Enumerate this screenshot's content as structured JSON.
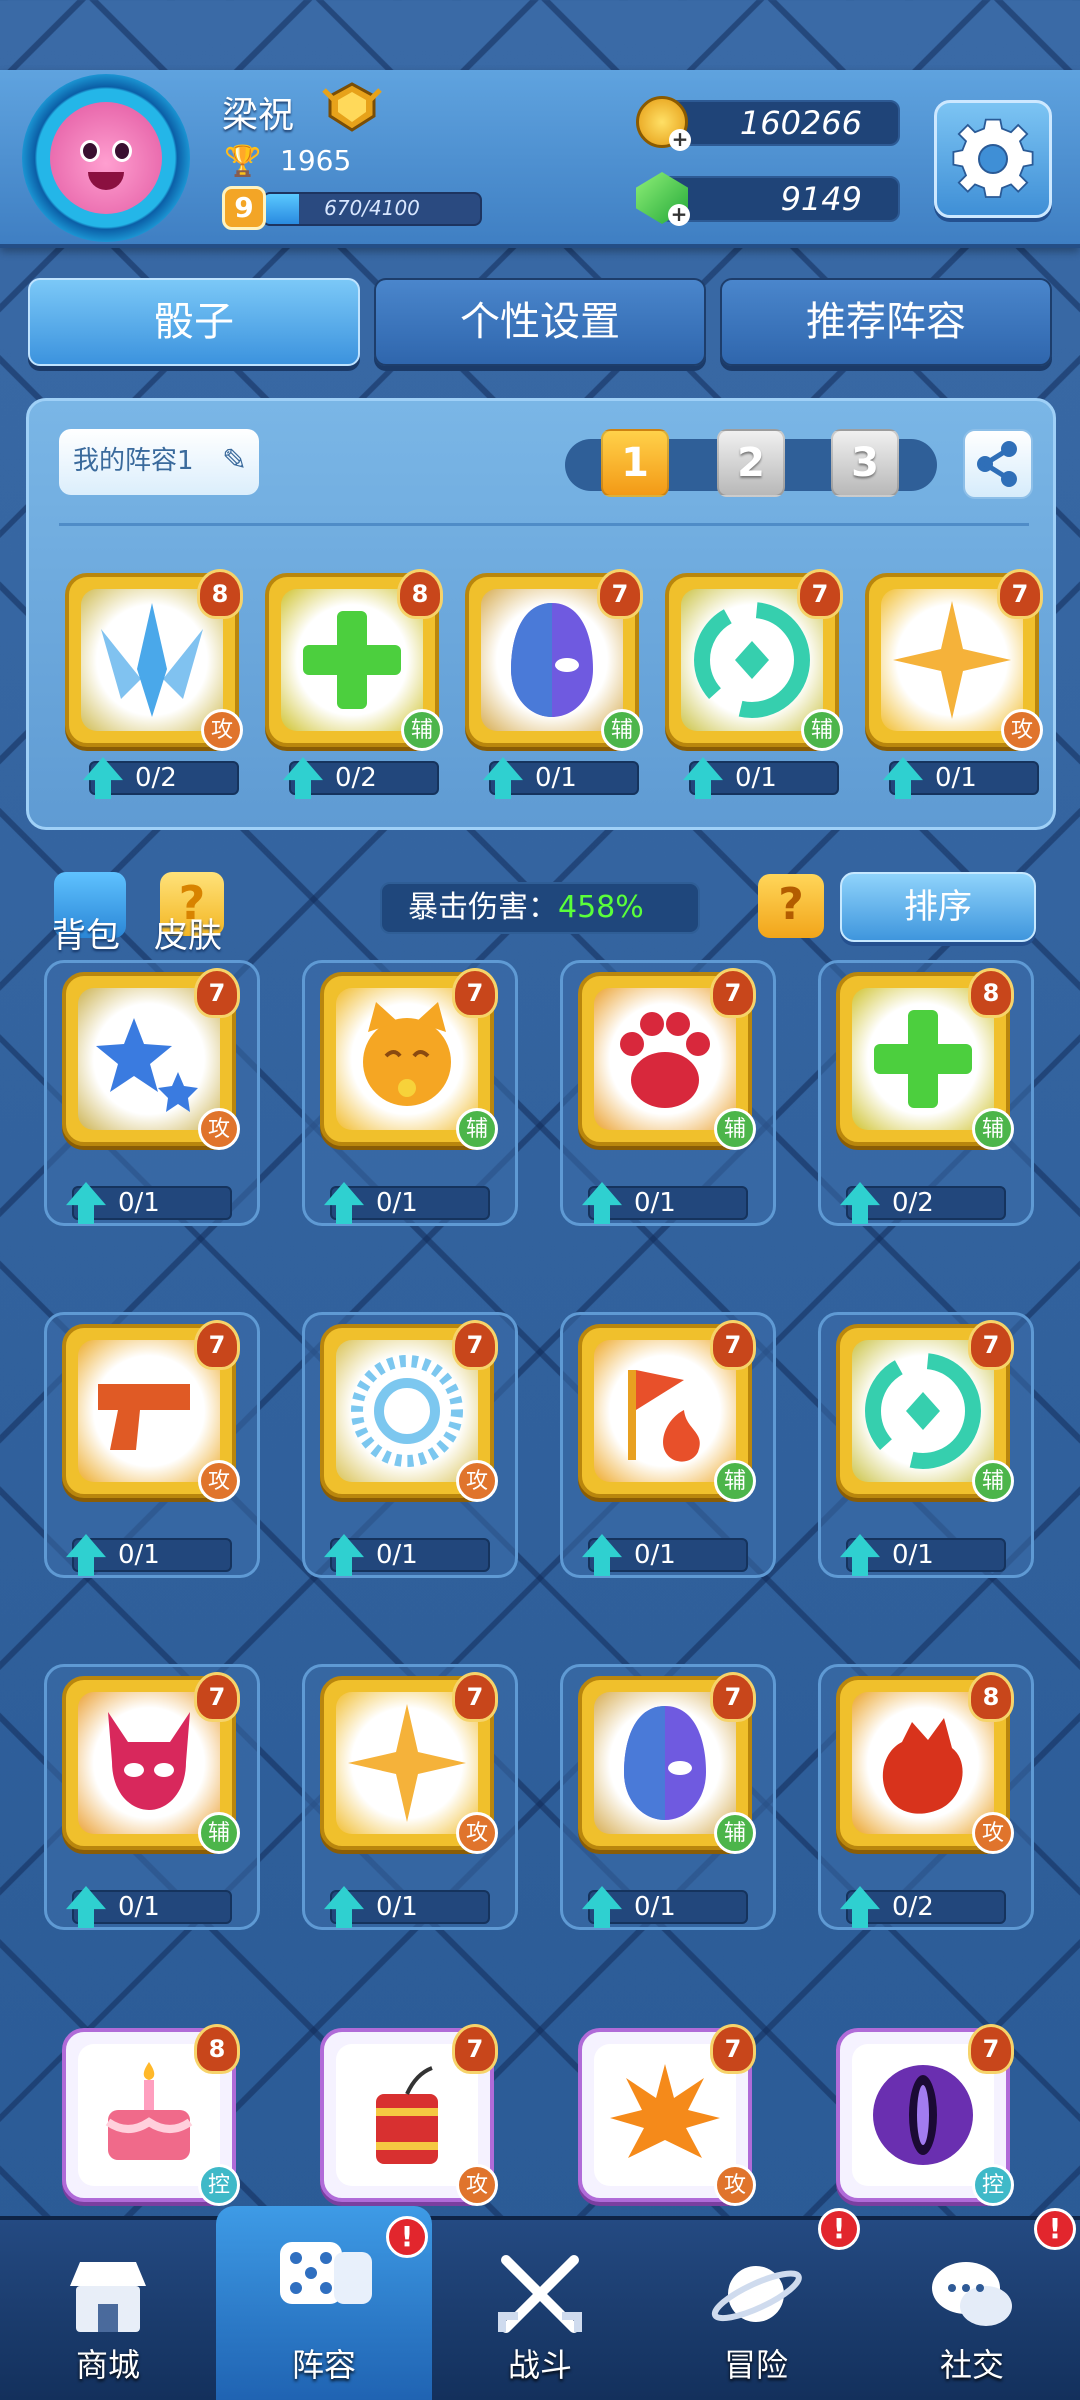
{
  "profile": {
    "name": "梁祝",
    "trophies": "1965",
    "level": "9",
    "xp_text": "670/4100",
    "xp_fraction": 0.163
  },
  "currency": {
    "gold": "160266",
    "gems": "9149"
  },
  "tabs": [
    {
      "label": "骰子"
    },
    {
      "label": "个性设置"
    },
    {
      "label": "推荐阵容"
    }
  ],
  "lineup": {
    "title": "我的阵容1",
    "pages": [
      "1",
      "2",
      "3"
    ],
    "active_page": "1",
    "cards": [
      {
        "level": "8",
        "type": "攻",
        "progress": "0/2",
        "icon": "blade-icon",
        "color": "#4aa8ea"
      },
      {
        "level": "8",
        "type": "辅",
        "progress": "0/2",
        "icon": "plus-icon",
        "color": "#4ccf3e"
      },
      {
        "level": "7",
        "type": "辅",
        "progress": "0/1",
        "icon": "mask-icon",
        "color": "#6f5ae0"
      },
      {
        "level": "7",
        "type": "辅",
        "progress": "0/1",
        "icon": "vortex-icon",
        "color": "#36cfae"
      },
      {
        "level": "7",
        "type": "攻",
        "progress": "0/1",
        "icon": "star-sparkle-icon",
        "color": "#f5b23a"
      }
    ]
  },
  "bag_label": "背包",
  "skin_label": "皮肤",
  "skin_glyph": "?",
  "crit": {
    "label": "暴击伤害：",
    "value": "458%"
  },
  "help_glyph": "?",
  "sort_label": "排序",
  "dice_grid": [
    {
      "level": "7",
      "type": "攻",
      "progress": "0/1",
      "icon": "stars-icon",
      "color": "#3a7be0"
    },
    {
      "level": "7",
      "type": "辅",
      "progress": "0/1",
      "icon": "lucky-cat-icon",
      "color": "#f5a623"
    },
    {
      "level": "7",
      "type": "辅",
      "progress": "0/1",
      "icon": "paw-icon",
      "color": "#d8283c"
    },
    {
      "level": "8",
      "type": "辅",
      "progress": "0/2",
      "icon": "plus-icon",
      "color": "#4ccf3e"
    },
    {
      "level": "7",
      "type": "攻",
      "progress": "0/1",
      "icon": "gun-icon",
      "color": "#e05a25"
    },
    {
      "level": "7",
      "type": "攻",
      "progress": "0/1",
      "icon": "ice-ring-icon",
      "color": "#7cc7ef"
    },
    {
      "level": "7",
      "type": "辅",
      "progress": "0/1",
      "icon": "flag-fire-icon",
      "color": "#e8502a"
    },
    {
      "level": "7",
      "type": "辅",
      "progress": "0/1",
      "icon": "vortex-icon",
      "color": "#36cfae"
    },
    {
      "level": "7",
      "type": "辅",
      "progress": "0/1",
      "icon": "demon-icon",
      "color": "#d8285c"
    },
    {
      "level": "7",
      "type": "攻",
      "progress": "0/1",
      "icon": "star-sparkle-icon",
      "color": "#f5b23a"
    },
    {
      "level": "7",
      "type": "辅",
      "progress": "0/1",
      "icon": "mask-icon",
      "color": "#6f5ae0"
    },
    {
      "level": "8",
      "type": "攻",
      "progress": "0/2",
      "icon": "fire-fist-icon",
      "color": "#d8331c"
    },
    {
      "level": "8",
      "type": "控",
      "progress": "",
      "icon": "cake-icon",
      "color": "#f06a8a"
    },
    {
      "level": "7",
      "type": "攻",
      "progress": "",
      "icon": "dynamite-icon",
      "color": "#d83030"
    },
    {
      "level": "7",
      "type": "攻",
      "progress": "",
      "icon": "explosion-icon",
      "color": "#f58a1a"
    },
    {
      "level": "7",
      "type": "控",
      "progress": "",
      "icon": "eye-icon",
      "color": "#6a2fb0"
    }
  ],
  "nav": [
    {
      "label": "商城",
      "icon": "shop-icon",
      "badge": ""
    },
    {
      "label": "阵容",
      "icon": "dice-icon",
      "badge": "!"
    },
    {
      "label": "战斗",
      "icon": "swords-icon",
      "badge": ""
    },
    {
      "label": "冒险",
      "icon": "planet-icon",
      "badge": "!"
    },
    {
      "label": "社交",
      "icon": "chat-icon",
      "badge": "!"
    }
  ]
}
